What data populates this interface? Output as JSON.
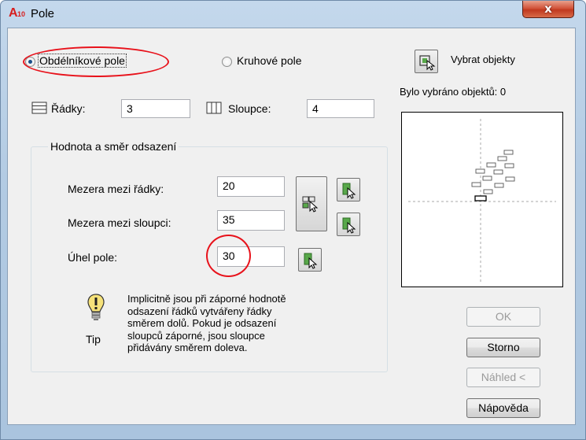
{
  "window": {
    "title": "Pole",
    "app_icon_letter": "A",
    "app_icon_number": "10",
    "close_glyph": "x"
  },
  "array_type": {
    "rectangular_label": "Obdélníkové pole",
    "polar_label": "Kruhové pole",
    "selected": "rectangular"
  },
  "select_objects": {
    "label": "Vybrat objekty",
    "status": "Bylo vybráno objektů: 0"
  },
  "rows": {
    "label": "Řádky:",
    "value": "3"
  },
  "columns": {
    "label": "Sloupce:",
    "value": "4"
  },
  "offset_group": {
    "title": "Hodnota a směr odsazení",
    "row_offset": {
      "label": "Mezera mezi řádky:",
      "value": "20"
    },
    "column_offset": {
      "label": "Mezera mezi sloupci:",
      "value": "35"
    },
    "angle": {
      "label": "Úhel pole:",
      "value": "30"
    }
  },
  "tip": {
    "caption": "Tip",
    "lines": [
      "Implicitně jsou při záporné hodnotě",
      "odsazení řádků vytvářeny řádky",
      "směrem dolů. Pokud je odsazení",
      "sloupců záporné, jsou sloupce",
      "přidávány směrem doleva."
    ]
  },
  "buttons": {
    "ok": "OK",
    "cancel": "Storno",
    "preview": "Náhled <",
    "help": "Nápověda"
  },
  "colors": {
    "annotation_ring": "#e8121b",
    "close_button": "#c0391f"
  }
}
